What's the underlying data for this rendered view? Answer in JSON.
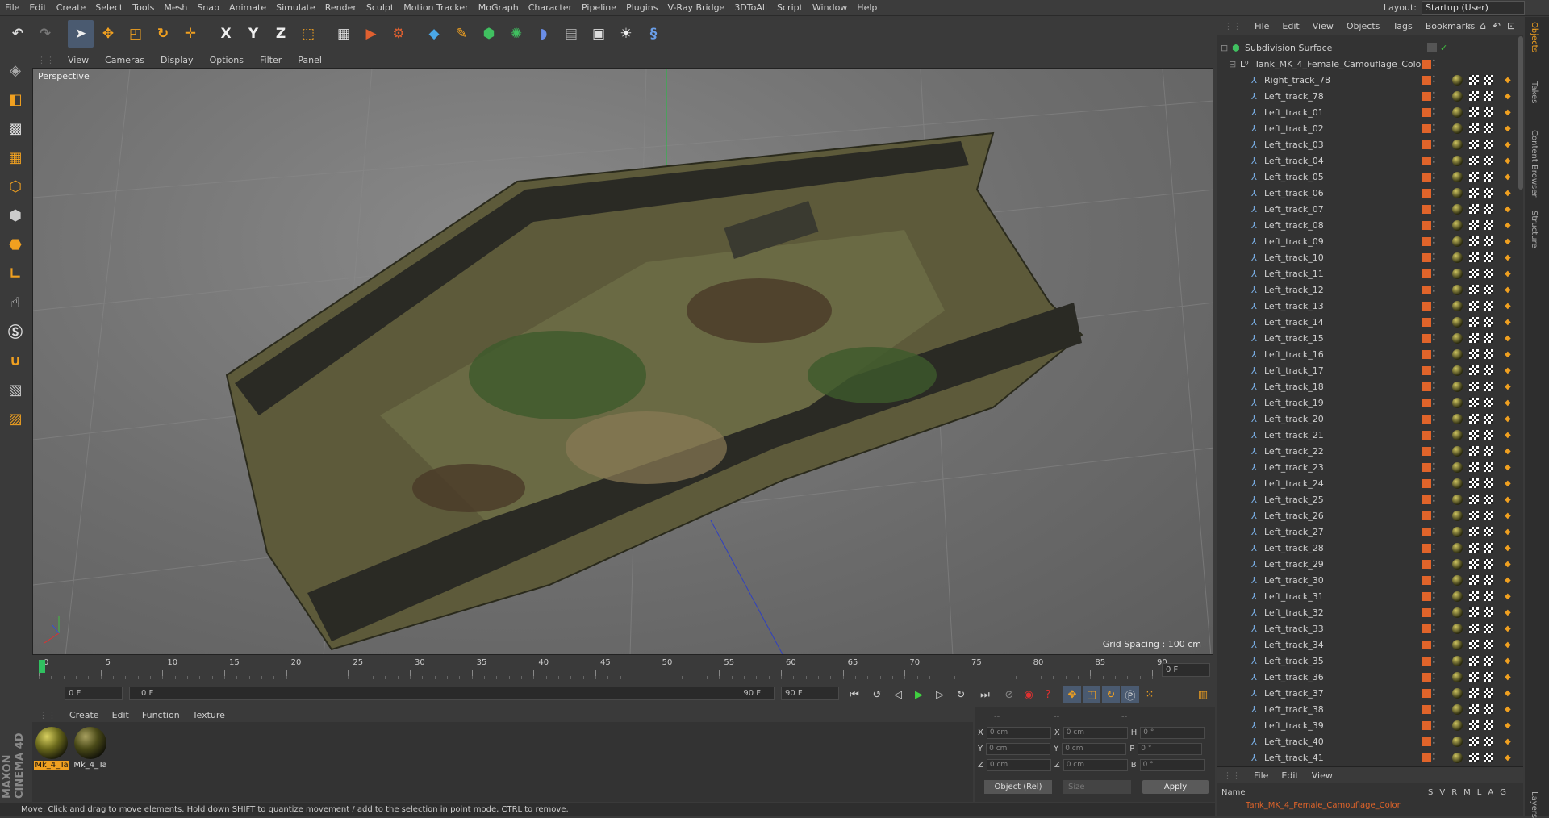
{
  "menubar": {
    "items": [
      "File",
      "Edit",
      "Create",
      "Select",
      "Tools",
      "Mesh",
      "Snap",
      "Animate",
      "Simulate",
      "Render",
      "Sculpt",
      "Motion Tracker",
      "MoGraph",
      "Character",
      "Pipeline",
      "Plugins",
      "V-Ray Bridge",
      "3DToAll",
      "Script",
      "Window",
      "Help"
    ],
    "layout_label": "Layout:",
    "layout_value": "Startup (User)"
  },
  "toolbar": {
    "icons": [
      "undo-icon",
      "redo-icon",
      "select-arrow-icon",
      "move-icon",
      "scale-icon",
      "rotate-icon",
      "live-select-icon",
      "x-axis-icon",
      "y-axis-icon",
      "z-axis-icon",
      "coordinate-system-icon",
      "render-view-icon",
      "render-picture-viewer-icon",
      "render-settings-icon",
      "cube-primitive-icon",
      "pen-spline-icon",
      "subdivision-nurbs-icon",
      "cloner-icon",
      "deformer-icon",
      "floor-scene-icon",
      "camera-icon",
      "light-icon",
      "python-icon"
    ],
    "axis_x": "X",
    "axis_y": "Y",
    "axis_z": "Z"
  },
  "viewport": {
    "menu": [
      "View",
      "Cameras",
      "Display",
      "Options",
      "Filter",
      "Panel"
    ],
    "label": "Perspective",
    "grid_spacing": "Grid Spacing : 100 cm"
  },
  "timeline": {
    "ticks": [
      "0",
      "5",
      "10",
      "15",
      "20",
      "25",
      "30",
      "35",
      "40",
      "45",
      "50",
      "55",
      "60",
      "65",
      "70",
      "75",
      "80",
      "85",
      "90"
    ],
    "current_frame_field": "0 F"
  },
  "transport": {
    "start_field": "0 F",
    "range_start": "0 F",
    "range_end": "90 F",
    "end_field": "90 F"
  },
  "materials": {
    "menu": [
      "Create",
      "Edit",
      "Function",
      "Texture"
    ],
    "items": [
      {
        "name": "Mk_4_Ta",
        "active": true
      },
      {
        "name": "Mk_4_Ta",
        "active": false
      }
    ]
  },
  "attributes": {
    "header_dashes": [
      "--",
      "--",
      "--"
    ],
    "rows": [
      {
        "l1": "X",
        "v1": "0 cm",
        "l2": "X",
        "v2": "0 cm",
        "l3": "H",
        "v3": "0 °"
      },
      {
        "l1": "Y",
        "v1": "0 cm",
        "l2": "Y",
        "v2": "0 cm",
        "l3": "P",
        "v3": "0 °"
      },
      {
        "l1": "Z",
        "v1": "0 cm",
        "l2": "Z",
        "v2": "0 cm",
        "l3": "B",
        "v3": "0 °"
      }
    ],
    "mode": "Object (Rel)",
    "size": "Size",
    "apply": "Apply"
  },
  "objects": {
    "menu": [
      "File",
      "Edit",
      "View",
      "Objects",
      "Tags",
      "Bookmarks"
    ],
    "root": "Subdivision Surface",
    "group": "Tank_MK_4_Female_Camouflage_Color",
    "items": [
      "Right_track_78",
      "Left_track_78",
      "Left_track_01",
      "Left_track_02",
      "Left_track_03",
      "Left_track_04",
      "Left_track_05",
      "Left_track_06",
      "Left_track_07",
      "Left_track_08",
      "Left_track_09",
      "Left_track_10",
      "Left_track_11",
      "Left_track_12",
      "Left_track_13",
      "Left_track_14",
      "Left_track_15",
      "Left_track_16",
      "Left_track_17",
      "Left_track_18",
      "Left_track_19",
      "Left_track_20",
      "Left_track_21",
      "Left_track_22",
      "Left_track_23",
      "Left_track_24",
      "Left_track_25",
      "Left_track_26",
      "Left_track_27",
      "Left_track_28",
      "Left_track_29",
      "Left_track_30",
      "Left_track_31",
      "Left_track_32",
      "Left_track_33",
      "Left_track_34",
      "Left_track_35",
      "Left_track_36",
      "Left_track_37",
      "Left_track_38",
      "Left_track_39",
      "Left_track_40",
      "Left_track_41"
    ]
  },
  "layers": {
    "menu": [
      "File",
      "Edit",
      "View"
    ],
    "name_header": "Name",
    "cols": [
      "S",
      "V",
      "R",
      "M",
      "L",
      "A",
      "G"
    ],
    "row": "Tank_MK_4_Female_Camouflage_Color"
  },
  "sidetabs": [
    "Objects",
    "Takes",
    "Content Browser",
    "Structure",
    "Layers"
  ],
  "status": "Move: Click and drag to move elements. Hold down SHIFT to quantize movement / add to the selection in point mode, CTRL to remove.",
  "brand": "MAXON CINEMA 4D"
}
